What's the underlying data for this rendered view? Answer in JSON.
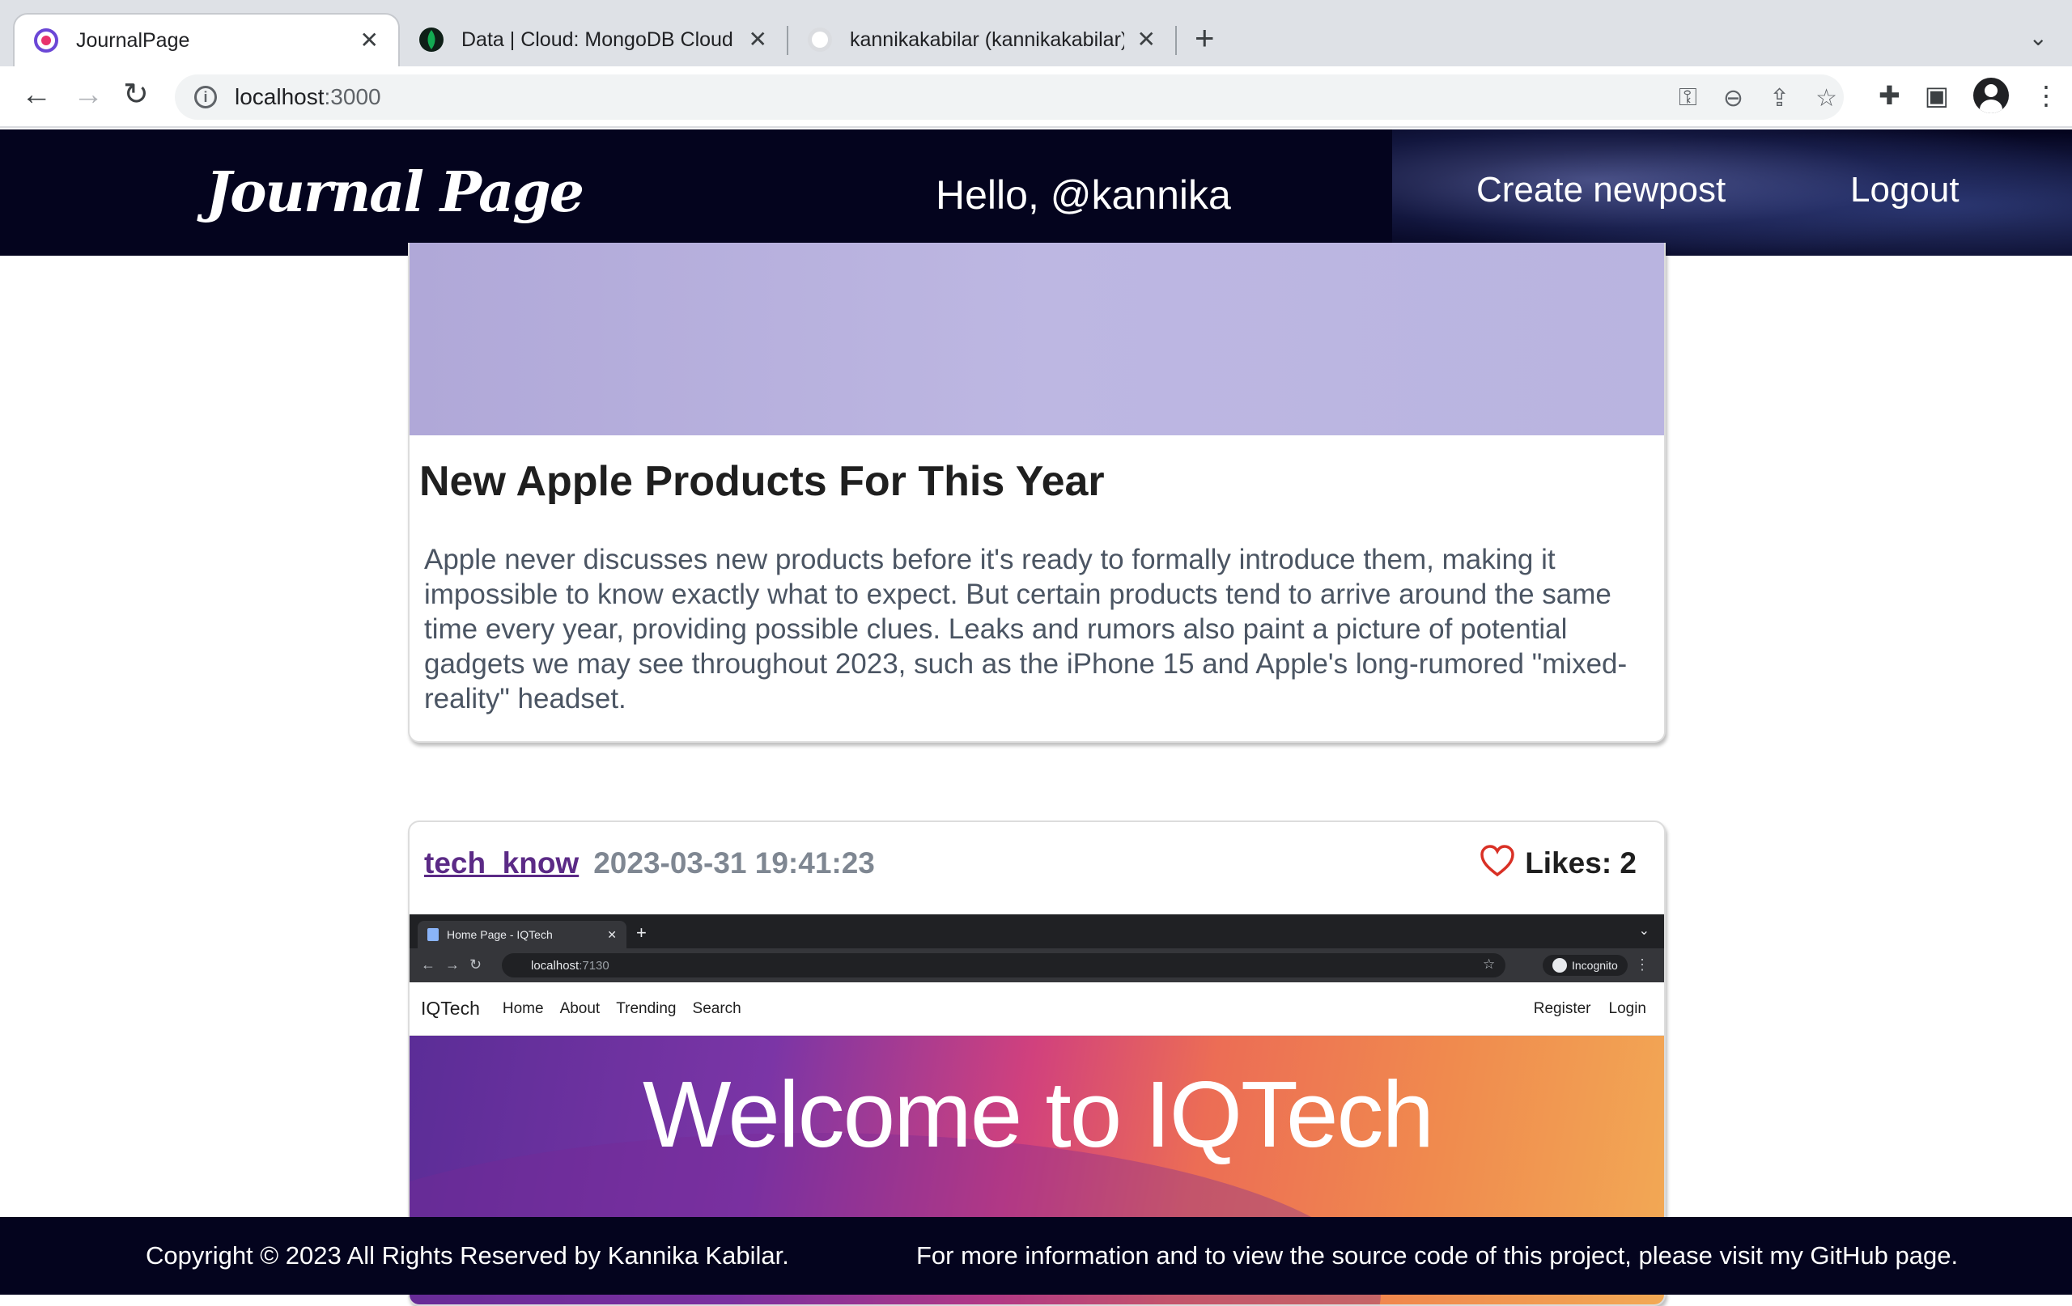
{
  "browser": {
    "tabs": [
      {
        "title": "JournalPage",
        "active": true,
        "icon": "journal-favicon"
      },
      {
        "title": "Data | Cloud: MongoDB Cloud",
        "active": false,
        "icon": "mongodb-leaf-icon"
      },
      {
        "title": "kannikakabilar (kannikakabilar)",
        "active": false,
        "icon": "github-icon"
      }
    ],
    "url_host": "localhost",
    "url_port": ":3000"
  },
  "site": {
    "logo": "Journal Page",
    "greeting": "Hello, @kannika",
    "nav": {
      "create": "Create newpost",
      "logout": "Logout"
    }
  },
  "posts": [
    {
      "title": "New Apple Products For This Year",
      "body": "Apple never discusses new products before it's ready to formally introduce them, making it impossible to know exactly what to expect. But certain products tend to arrive around the same time every year, providing possible clues. Leaks and rumors also paint a picture of potential gadgets we may see throughout 2023, such as the iPhone 15 and Apple's long-rumored \"mixed-reality\" headset."
    },
    {
      "author": "tech_know",
      "date": "2023-03-31 19:41:23",
      "likes": "Likes: 2",
      "image": {
        "tab_title": "Home Page - IQTech",
        "url_host": "localhost",
        "url_port": ":7130",
        "incognito": "Incognito",
        "brand": "IQTech",
        "links": [
          "Home",
          "About",
          "Trending",
          "Search"
        ],
        "right_links": [
          "Register",
          "Login"
        ],
        "hero_title": "Welcome to IQTech"
      }
    }
  ],
  "footer": {
    "copyright": "Copyright © 2023 All Rights Reserved by Kannika Kabilar.",
    "info": "For more information and to view the source code of this project, please visit my GitHub page."
  },
  "colors": {
    "header_bg": "#04041e",
    "author_link": "#5b2a86",
    "heart": "#d93025"
  }
}
